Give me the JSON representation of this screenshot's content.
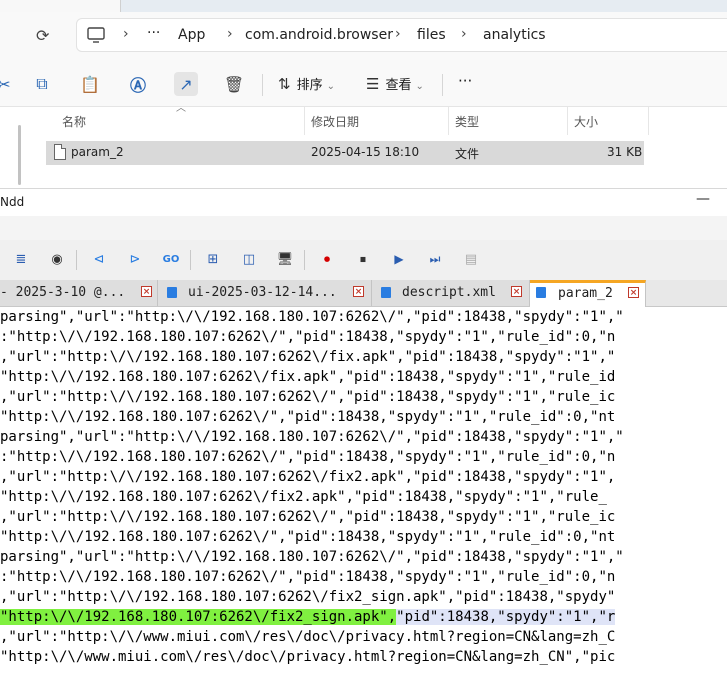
{
  "explorer": {
    "top_tab_label": "",
    "breadcrumbs": [
      "App",
      "com.android.browser",
      "files",
      "analytics"
    ],
    "breadcrumb_more": "···",
    "toolbar": {
      "sort_label": "排序",
      "view_label": "查看",
      "more_label": "···"
    },
    "columns": [
      "名称",
      "修改日期",
      "类型",
      "大小"
    ],
    "files": [
      {
        "name": "param_2",
        "modified": "2025-04-15 18:10",
        "type": "文件",
        "size": "31 KB"
      }
    ]
  },
  "editor": {
    "title": "Ndd",
    "minimize": "—",
    "tabs": [
      {
        "label": "- 2025-3-10 @...",
        "active": false
      },
      {
        "label": "ui-2025-03-12-14...",
        "active": false
      },
      {
        "label": "descript.xml",
        "active": false
      },
      {
        "label": "param_2",
        "active": true
      }
    ],
    "lines": [
      "parsing\",\"url\":\"http:\\/\\/192.168.180.107:6262\\/\",\"pid\":18438,\"spydy\":\"1\",\"",
      ":\"http:\\/\\/192.168.180.107:6262\\/\",\"pid\":18438,\"spydy\":\"1\",\"rule_id\":0,\"n",
      ",\"url\":\"http:\\/\\/192.168.180.107:6262\\/fix.apk\",\"pid\":18438,\"spydy\":\"1\",\"",
      "\"http:\\/\\/192.168.180.107:6262\\/fix.apk\",\"pid\":18438,\"spydy\":\"1\",\"rule_id",
      ",\"url\":\"http:\\/\\/192.168.180.107:6262\\/\",\"pid\":18438,\"spydy\":\"1\",\"rule_ic",
      "\"http:\\/\\/192.168.180.107:6262\\/\",\"pid\":18438,\"spydy\":\"1\",\"rule_id\":0,\"nt",
      "parsing\",\"url\":\"http:\\/\\/192.168.180.107:6262\\/\",\"pid\":18438,\"spydy\":\"1\",\"",
      ":\"http:\\/\\/192.168.180.107:6262\\/\",\"pid\":18438,\"spydy\":\"1\",\"rule_id\":0,\"n",
      ",\"url\":\"http:\\/\\/192.168.180.107:6262\\/fix2.apk\",\"pid\":18438,\"spydy\":\"1\",",
      "\"http:\\/\\/192.168.180.107:6262\\/fix2.apk\",\"pid\":18438,\"spydy\":\"1\",\"rule_",
      ",\"url\":\"http:\\/\\/192.168.180.107:6262\\/\",\"pid\":18438,\"spydy\":\"1\",\"rule_ic",
      "\"http:\\/\\/192.168.180.107:6262\\/\",\"pid\":18438,\"spydy\":\"1\",\"rule_id\":0,\"nt",
      "parsing\",\"url\":\"http:\\/\\/192.168.180.107:6262\\/\",\"pid\":18438,\"spydy\":\"1\",\"",
      ":\"http:\\/\\/192.168.180.107:6262\\/\",\"pid\":18438,\"spydy\":\"1\",\"rule_id\":0,\"n",
      ",\"url\":\"http:\\/\\/192.168.180.107:6262\\/fix2_sign.apk\",\"pid\":18438,\"spydy\"",
      "",
      ",\"url\":\"http:\\/\\/www.miui.com\\/res\\/doc\\/privacy.html?region=CN&lang=zh_C",
      "\"http:\\/\\/www.miui.com\\/res\\/doc\\/privacy.html?region=CN&lang=zh_CN\",\"pic",
      "                                                                                   "
    ],
    "highlight_line": {
      "prefix": "",
      "green": "\"http:\\/\\/192.168.180.107:6262\\/fix2_sign.apk\",",
      "blue": "\"pid\":18438,\"spydy\":\"1\",\"r"
    }
  }
}
